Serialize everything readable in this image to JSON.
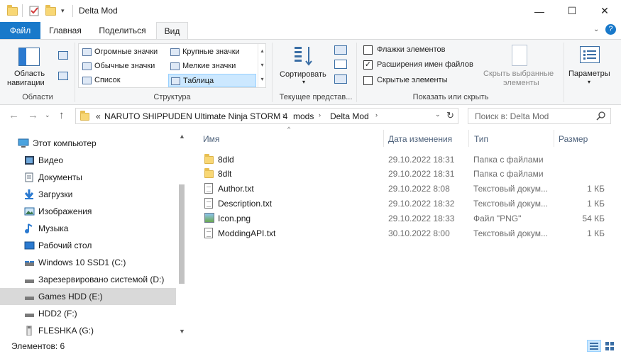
{
  "window": {
    "title": "Delta Mod",
    "minimize_glyph": "—",
    "maximize_glyph": "☐",
    "close_glyph": "✕"
  },
  "ribbon_tabs": [
    "Файл",
    "Главная",
    "Поделиться",
    "Вид"
  ],
  "ribbon": {
    "panes": {
      "nav_pane_label_line1": "Область",
      "nav_pane_label_line2": "навигации",
      "group_label": "Области"
    },
    "layout": {
      "items": [
        "Огромные значки",
        "Крупные значки",
        "Обычные значки",
        "Мелкие значки",
        "Список",
        "Таблица"
      ],
      "selected": "Таблица",
      "group_label": "Структура"
    },
    "current_view": {
      "sort_label": "Сортировать",
      "group_label": "Текущее представ..."
    },
    "show_hide": {
      "item_checkboxes": "Флажки элементов",
      "file_extensions": "Расширения имен файлов",
      "hidden_items": "Скрытые элементы",
      "hide_selected_line1": "Скрыть выбранные",
      "hide_selected_line2": "элементы",
      "group_label": "Показать или скрыть"
    },
    "options_label": "Параметры"
  },
  "address": {
    "overflow": "«",
    "segments": [
      "NARUTO SHIPPUDEN Ultimate Ninja STORM 4",
      "mods",
      "Delta Mod"
    ],
    "search_placeholder": "Поиск в: Delta Mod"
  },
  "nav_pane": {
    "items": [
      {
        "label": "Этот компьютер",
        "icon": "computer-icon"
      },
      {
        "label": "Видео",
        "icon": "video-icon"
      },
      {
        "label": "Документы",
        "icon": "documents-icon"
      },
      {
        "label": "Загрузки",
        "icon": "downloads-icon"
      },
      {
        "label": "Изображения",
        "icon": "pictures-icon"
      },
      {
        "label": "Музыка",
        "icon": "music-icon"
      },
      {
        "label": "Рабочий стол",
        "icon": "desktop-icon"
      },
      {
        "label": "Windows 10 SSD1 (C:)",
        "icon": "drive-icon"
      },
      {
        "label": "Зарезервировано системой (D:)",
        "icon": "drive-icon"
      },
      {
        "label": "Games HDD (E:)",
        "icon": "drive-icon"
      },
      {
        "label": "HDD2 (F:)",
        "icon": "drive-icon"
      },
      {
        "label": "FLESHKA (G:)",
        "icon": "usb-drive-icon"
      }
    ],
    "selected": "Games HDD (E:)"
  },
  "file_list": {
    "columns": [
      "Имя",
      "Дата изменения",
      "Тип",
      "Размер"
    ],
    "rows": [
      {
        "name": "8dld",
        "date": "29.10.2022 18:31",
        "type": "Папка с файлами",
        "size": "",
        "icon": "folder-icon"
      },
      {
        "name": "8dlt",
        "date": "29.10.2022 18:31",
        "type": "Папка с файлами",
        "size": "",
        "icon": "folder-icon"
      },
      {
        "name": "Author.txt",
        "date": "29.10.2022 8:08",
        "type": "Текстовый докум...",
        "size": "1 КБ",
        "icon": "text-file-icon"
      },
      {
        "name": "Description.txt",
        "date": "29.10.2022 18:32",
        "type": "Текстовый докум...",
        "size": "1 КБ",
        "icon": "text-file-icon"
      },
      {
        "name": "Icon.png",
        "date": "29.10.2022 18:33",
        "type": "Файл \"PNG\"",
        "size": "54 КБ",
        "icon": "image-file-icon"
      },
      {
        "name": "ModdingAPI.txt",
        "date": "30.10.2022 8:00",
        "type": "Текстовый докум...",
        "size": "1 КБ",
        "icon": "text-file-icon"
      }
    ]
  },
  "status": {
    "item_count": "Элементов: 6"
  }
}
